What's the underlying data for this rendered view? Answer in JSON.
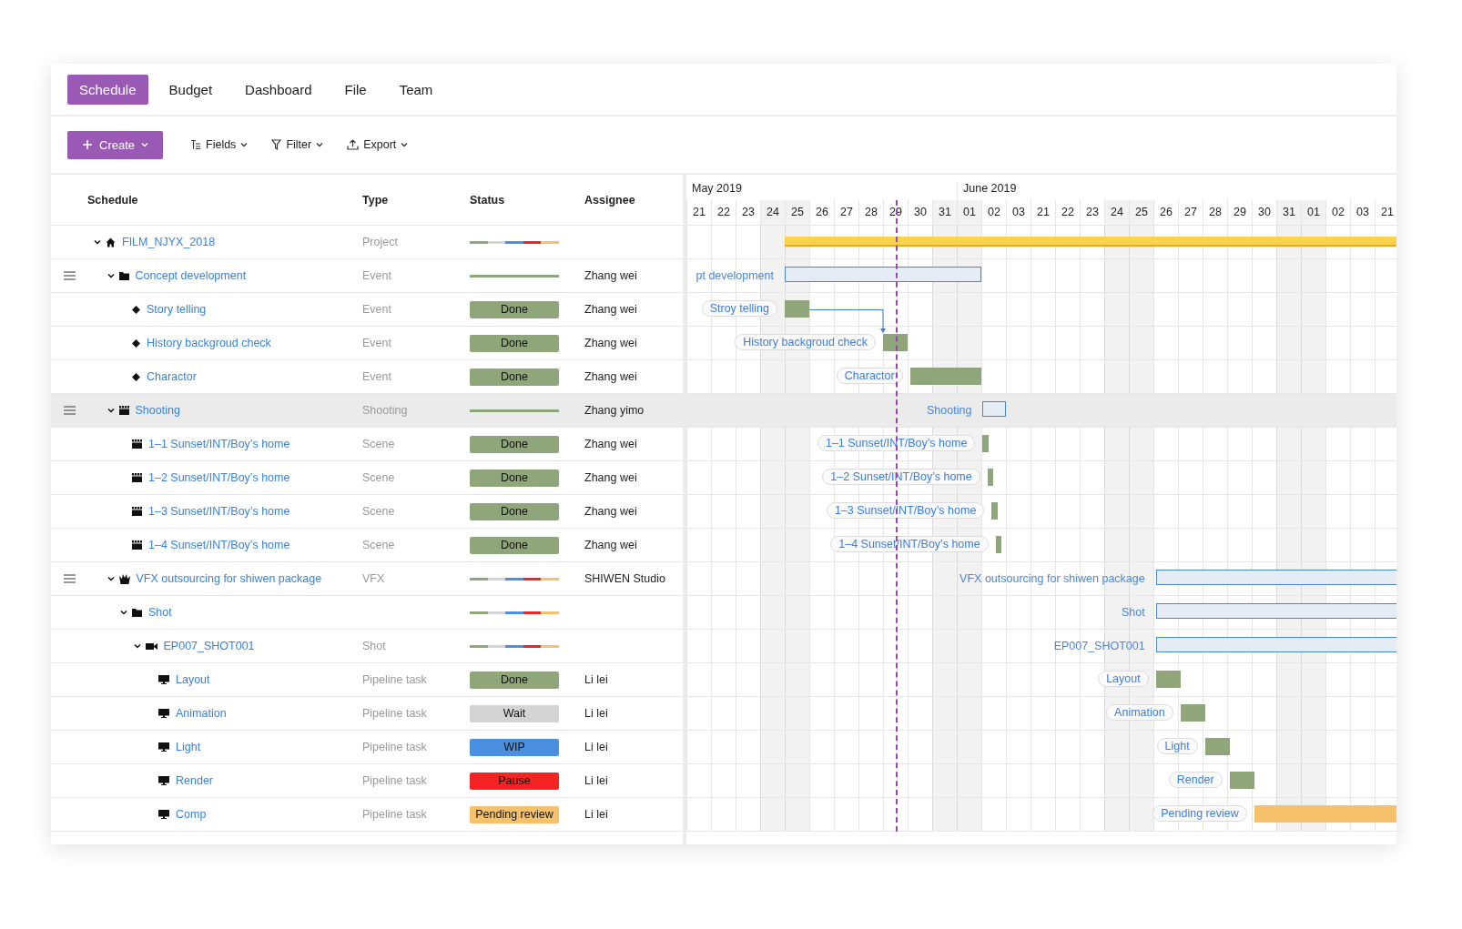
{
  "tabs": [
    {
      "label": "Schedule",
      "selected": true
    },
    {
      "label": "Budget",
      "selected": false
    },
    {
      "label": "Dashboard",
      "selected": false
    },
    {
      "label": "File",
      "selected": false
    },
    {
      "label": "Team",
      "selected": false
    }
  ],
  "toolbar": {
    "create": "Create",
    "tools": [
      {
        "kind": "fields",
        "label": "Fields"
      },
      {
        "kind": "filter",
        "label": "Filter"
      },
      {
        "kind": "export",
        "label": "Export"
      }
    ]
  },
  "columns": [
    "Schedule",
    "Type",
    "Status",
    "Assignee"
  ],
  "timeline": {
    "months": [
      {
        "label": "May 2019"
      },
      {
        "label": "June 2019"
      }
    ],
    "days": [
      {
        "label": "21",
        "shaded": false,
        "today": false
      },
      {
        "label": "22",
        "shaded": false,
        "today": false
      },
      {
        "label": "23",
        "shaded": false,
        "today": false
      },
      {
        "label": "24",
        "shaded": true,
        "today": false
      },
      {
        "label": "25",
        "shaded": true,
        "today": false
      },
      {
        "label": "26",
        "shaded": false,
        "today": false
      },
      {
        "label": "27",
        "shaded": false,
        "today": false
      },
      {
        "label": "28",
        "shaded": false,
        "today": false
      },
      {
        "label": "29",
        "shaded": false,
        "today": true
      },
      {
        "label": "30",
        "shaded": false,
        "today": false
      },
      {
        "label": "31",
        "shaded": true,
        "today": false
      },
      {
        "label": "01",
        "shaded": true,
        "today": false
      },
      {
        "label": "02",
        "shaded": false,
        "today": false
      },
      {
        "label": "03",
        "shaded": false,
        "today": false
      },
      {
        "label": "21",
        "shaded": false,
        "today": false
      },
      {
        "label": "22",
        "shaded": false,
        "today": false
      },
      {
        "label": "23",
        "shaded": false,
        "today": false
      },
      {
        "label": "24",
        "shaded": true,
        "today": false
      },
      {
        "label": "25",
        "shaded": true,
        "today": false
      },
      {
        "label": "26",
        "shaded": false,
        "today": false
      },
      {
        "label": "27",
        "shaded": false,
        "today": false
      },
      {
        "label": "28",
        "shaded": false,
        "today": false
      },
      {
        "label": "29",
        "shaded": false,
        "today": false
      },
      {
        "label": "30",
        "shaded": false,
        "today": false
      },
      {
        "label": "31",
        "shaded": true,
        "today": false
      },
      {
        "label": "01",
        "shaded": true,
        "today": false
      },
      {
        "label": "02",
        "shaded": false,
        "today": false
      },
      {
        "label": "03",
        "shaded": false,
        "today": false
      },
      {
        "label": "21",
        "shaded": false,
        "today": false
      }
    ]
  },
  "rows": [
    {
      "name": "FILM_NJYX_2018",
      "kind": "project",
      "type": "Project",
      "handle": false,
      "expanded": true,
      "selected": false,
      "status": {
        "kind": "segments"
      },
      "bar": {
        "kind": "project"
      },
      "children": [
        {
          "name": "Concept development",
          "kind": "folder",
          "type": "Event",
          "handle": true,
          "expanded": true,
          "selected": false,
          "status": {
            "kind": "line",
            "color": "#8fa57a"
          },
          "assignee": "Zhang wei",
          "bar": {
            "kind": "summary",
            "label": "pt development"
          },
          "children": [
            {
              "name": "Story telling",
              "kind": "event",
              "type": "Event",
              "handle": false,
              "selected": false,
              "status": {
                "kind": "badge",
                "label": "Done",
                "color": "#8fa57a"
              },
              "assignee": "Zhang wei",
              "bar": {
                "kind": "task",
                "label": "Stroy telling",
                "color": "#8fa57a",
                "after_previous": false
              }
            },
            {
              "name": "History backgroud check",
              "kind": "event",
              "type": "Event",
              "handle": false,
              "selected": false,
              "status": {
                "kind": "badge",
                "label": "Done",
                "color": "#8fa57a"
              },
              "assignee": "Zhang wei",
              "bar": {
                "kind": "task",
                "label": "History backgroud check",
                "color": "#8fa57a",
                "after_previous": true
              }
            },
            {
              "name": "Charactor",
              "kind": "event",
              "type": "Event",
              "handle": false,
              "selected": false,
              "status": {
                "kind": "badge",
                "label": "Done",
                "color": "#8fa57a"
              },
              "assignee": "Zhang wei",
              "bar": {
                "kind": "task",
                "label": "Charactor",
                "color": "#8fa57a",
                "after_previous": false
              }
            }
          ]
        },
        {
          "name": "Shooting",
          "kind": "shooting",
          "type": "Shooting",
          "handle": true,
          "expanded": true,
          "selected": true,
          "status": {
            "kind": "line",
            "color": "#8fa57a"
          },
          "assignee": "Zhang yimo",
          "bar": {
            "kind": "summary",
            "label": "Shooting"
          },
          "children": [
            {
              "name": "1–1 Sunset/INT/Boy’s home",
              "kind": "scene",
              "type": "Scene",
              "handle": false,
              "selected": false,
              "status": {
                "kind": "badge",
                "label": "Done",
                "color": "#8fa57a"
              },
              "assignee": "Zhang wei",
              "bar": {
                "kind": "task",
                "label": "1–1 Sunset/INT/Boy’s home",
                "color": "#8fa57a",
                "after_previous": false
              }
            },
            {
              "name": "1–2 Sunset/INT/Boy’s home",
              "kind": "scene",
              "type": "Scene",
              "handle": false,
              "selected": false,
              "status": {
                "kind": "badge",
                "label": "Done",
                "color": "#8fa57a"
              },
              "assignee": "Zhang wei",
              "bar": {
                "kind": "task",
                "label": "1–2 Sunset/INT/Boy’s home",
                "color": "#8fa57a",
                "after_previous": false
              }
            },
            {
              "name": "1–3 Sunset/INT/Boy’s home",
              "kind": "scene",
              "type": "Scene",
              "handle": false,
              "selected": false,
              "status": {
                "kind": "badge",
                "label": "Done",
                "color": "#8fa57a"
              },
              "assignee": "Zhang wei",
              "bar": {
                "kind": "task",
                "label": "1–3 Sunset/INT/Boy’s home",
                "color": "#8fa57a",
                "after_previous": false
              }
            },
            {
              "name": "1–4 Sunset/INT/Boy’s home",
              "kind": "scene",
              "type": "Scene",
              "handle": false,
              "selected": false,
              "status": {
                "kind": "badge",
                "label": "Done",
                "color": "#8fa57a"
              },
              "assignee": "Zhang wei",
              "bar": {
                "kind": "task",
                "label": "1–4 Sunset/INT/Boy’s home",
                "color": "#8fa57a",
                "after_previous": false
              }
            }
          ]
        },
        {
          "name": "VFX outsourcing for shiwen package",
          "kind": "vfx",
          "type": "VFX",
          "handle": true,
          "expanded": true,
          "selected": false,
          "status": {
            "kind": "segments"
          },
          "assignee": "SHIWEN Studio",
          "bar": {
            "kind": "summary",
            "label": "VFX outsourcing for shiwen package"
          },
          "children": [
            {
              "name": "Shot",
              "kind": "folder",
              "handle": false,
              "expanded": true,
              "selected": false,
              "status": {
                "kind": "segments"
              },
              "bar": {
                "kind": "summary",
                "label": "Shot"
              },
              "children": [
                {
                  "name": "EP007_SHOT001",
                  "kind": "shot",
                  "type": "Shot",
                  "handle": false,
                  "expanded": true,
                  "selected": false,
                  "status": {
                    "kind": "segments"
                  },
                  "bar": {
                    "kind": "summary",
                    "label": "EP007_SHOT001"
                  },
                  "children": [
                    {
                      "name": "Layout",
                      "kind": "pipeline",
                      "type": "Pipeline task",
                      "handle": false,
                      "selected": false,
                      "status": {
                        "kind": "badge",
                        "label": "Done",
                        "color": "#8fa57a"
                      },
                      "assignee": "Li lei",
                      "bar": {
                        "kind": "task",
                        "label": "Layout",
                        "color": "#8fa57a",
                        "after_previous": false
                      }
                    },
                    {
                      "name": "Animation",
                      "kind": "pipeline",
                      "type": "Pipeline task",
                      "handle": false,
                      "selected": false,
                      "status": {
                        "kind": "badge",
                        "label": "Wait",
                        "color": "#d4d4d4"
                      },
                      "assignee": "Li lei",
                      "bar": {
                        "kind": "task",
                        "label": "Animation",
                        "color": "#8fa57a",
                        "after_previous": false
                      }
                    },
                    {
                      "name": "Light",
                      "kind": "pipeline",
                      "type": "Pipeline task",
                      "handle": false,
                      "selected": false,
                      "status": {
                        "kind": "badge",
                        "label": "WIP",
                        "color": "#4a8fe0"
                      },
                      "assignee": "Li lei",
                      "bar": {
                        "kind": "task",
                        "label": "Light",
                        "color": "#8fa57a",
                        "after_previous": false
                      }
                    },
                    {
                      "name": "Render",
                      "kind": "pipeline",
                      "type": "Pipeline task",
                      "handle": false,
                      "selected": false,
                      "status": {
                        "kind": "badge",
                        "label": "Pause",
                        "color": "#f52424"
                      },
                      "assignee": "Li lei",
                      "bar": {
                        "kind": "task",
                        "label": "Render",
                        "color": "#8fa57a",
                        "after_previous": false
                      }
                    },
                    {
                      "name": "Comp",
                      "kind": "pipeline",
                      "type": "Pipeline task",
                      "handle": false,
                      "selected": false,
                      "status": {
                        "kind": "badge",
                        "label": "Pending review",
                        "color": "#f5c26b"
                      },
                      "assignee": "Li lei",
                      "bar": {
                        "kind": "task",
                        "label": "Pending review",
                        "color": "#f5c26b",
                        "after_previous": false
                      }
                    }
                  ]
                }
              ]
            }
          ]
        }
      ]
    }
  ]
}
